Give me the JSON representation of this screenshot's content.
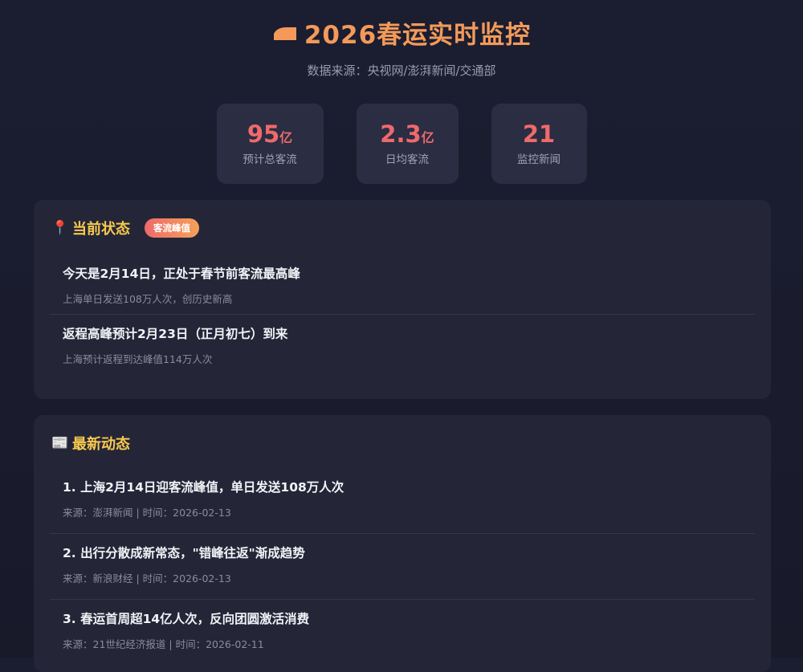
{
  "header": {
    "title": "2026春运实时监控",
    "subtitle": "数据来源：央视网/澎湃新闻/交通部",
    "icon": "train-icon"
  },
  "stats": [
    {
      "value": "95",
      "unit": "亿",
      "label": "预计总客流"
    },
    {
      "value": "2.3",
      "unit": "亿",
      "label": "日均客流"
    },
    {
      "value": "21",
      "unit": "",
      "label": "监控新闻"
    }
  ],
  "status": {
    "icon": "📍",
    "title": "当前状态",
    "badge": "客流峰值",
    "items": [
      {
        "title": "今天是2月14日，正处于春节前客流最高峰",
        "sub": "上海单日发送108万人次，创历史新高"
      },
      {
        "title": "返程高峰预计2月23日（正月初七）到来",
        "sub": "上海预计返程到达峰值114万人次"
      }
    ]
  },
  "news": {
    "icon": "📰",
    "title": "最新动态",
    "items": [
      {
        "title": "1. 上海2月14日迎客流峰值，单日发送108万人次",
        "sub": "来源：澎湃新闻 | 时间：2026-02-13"
      },
      {
        "title": "2. 出行分散成新常态，\"错峰往返\"渐成趋势",
        "sub": "来源：新浪财经 | 时间：2026-02-13"
      },
      {
        "title": "3. 春运首周超14亿人次，反向团圆激活消费",
        "sub": "来源：21世纪经济报道 | 时间：2026-02-11"
      }
    ]
  },
  "colors": {
    "accent_orange": "#f39a5a",
    "stat_red": "#ee6a6c",
    "section_gold": "#f7c84e"
  }
}
